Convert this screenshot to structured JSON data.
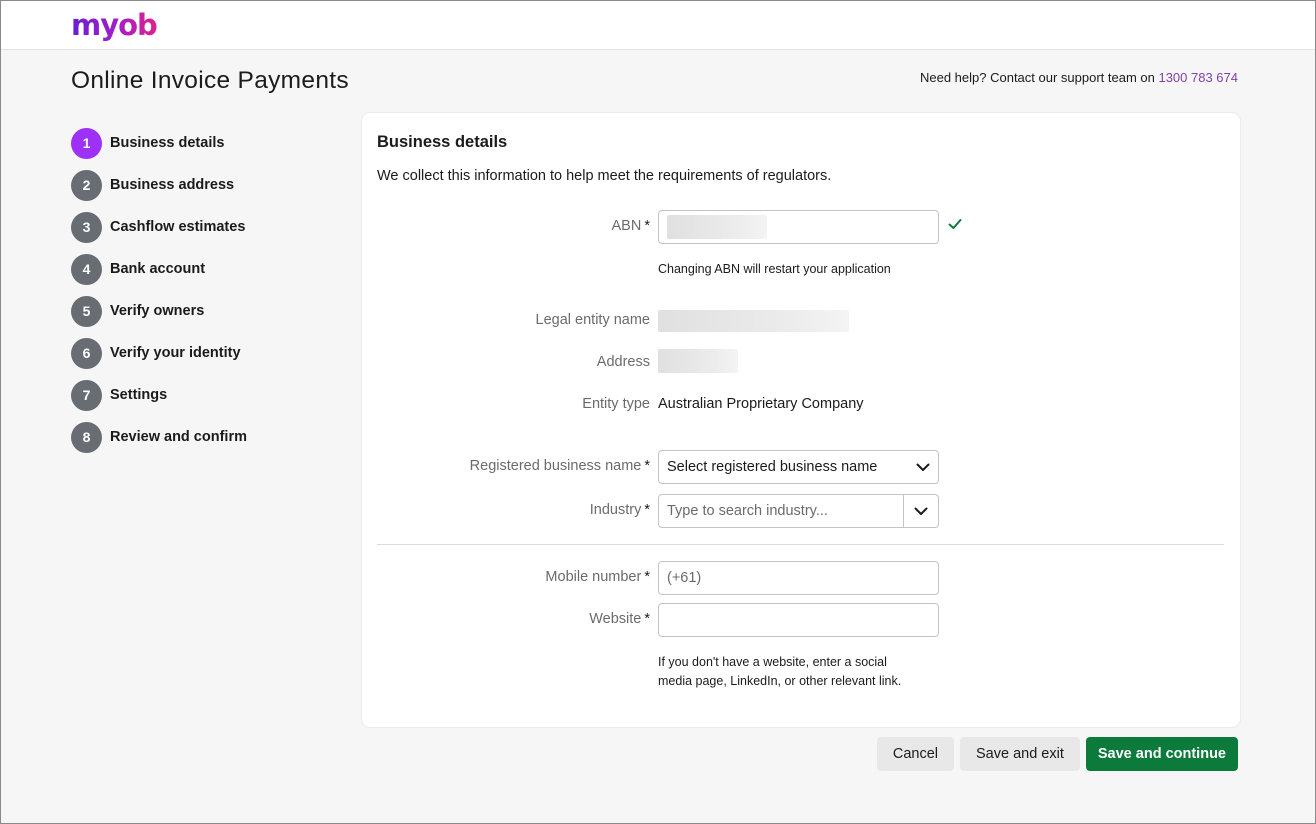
{
  "brand": {
    "logo_text": "myob",
    "logo_colors": [
      "#6a1fd1",
      "#e0208a"
    ]
  },
  "page": {
    "title": "Online Invoice Payments"
  },
  "help": {
    "text": "Need help? Contact our support team on ",
    "phone": "1300 783 674"
  },
  "steps": [
    {
      "num": "1",
      "label": "Business details",
      "active": true
    },
    {
      "num": "2",
      "label": "Business address"
    },
    {
      "num": "3",
      "label": "Cashflow estimates"
    },
    {
      "num": "4",
      "label": "Bank account"
    },
    {
      "num": "5",
      "label": "Verify owners"
    },
    {
      "num": "6",
      "label": "Verify your identity"
    },
    {
      "num": "7",
      "label": "Settings"
    },
    {
      "num": "8",
      "label": "Review and confirm"
    }
  ],
  "form": {
    "title": "Business details",
    "description": "We collect this information to help meet the requirements of regulators.",
    "required_marker": "*",
    "abn": {
      "label": "ABN",
      "hint": "Changing ABN will restart your application",
      "status_icon": "check-icon"
    },
    "legal_entity_name": {
      "label": "Legal entity name"
    },
    "address": {
      "label": "Address"
    },
    "entity_type": {
      "label": "Entity type",
      "value": "Australian Proprietary Company"
    },
    "registered_business_name": {
      "label": "Registered business name",
      "value": "Select registered business name"
    },
    "industry": {
      "label": "Industry",
      "placeholder": "Type to search industry..."
    },
    "mobile_number": {
      "label": "Mobile number",
      "placeholder": "(+61)"
    },
    "website": {
      "label": "Website",
      "hint_line1": "If you don't have a website, enter a social",
      "hint_line2": "media page, LinkedIn, or other relevant link."
    }
  },
  "actions": {
    "cancel": "Cancel",
    "save_exit": "Save and exit",
    "save_continue": "Save and continue"
  },
  "colors": {
    "accent": "#9d31f5",
    "primary_button": "#0b7a3a",
    "link": "#8241aa",
    "success": "#0b7a3a"
  }
}
